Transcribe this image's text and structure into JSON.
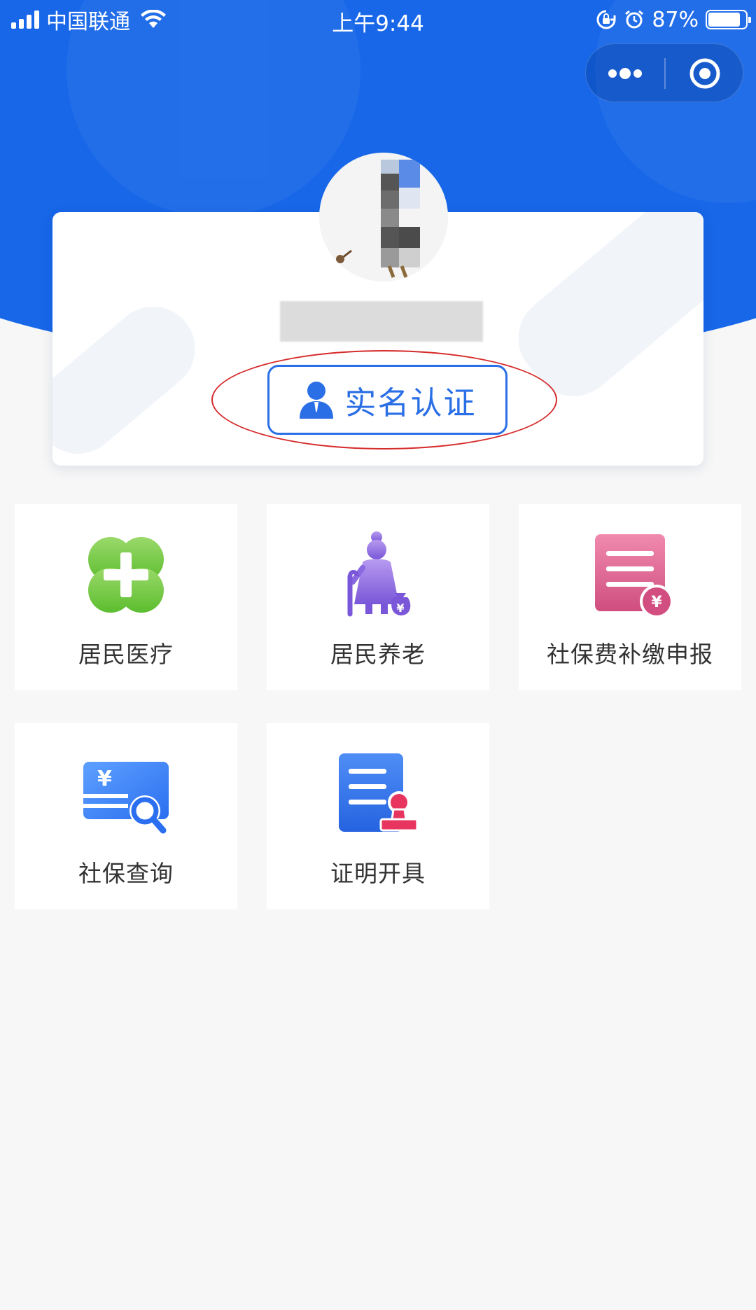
{
  "status_bar": {
    "carrier": "中国联通",
    "time": "上午9:44",
    "battery_percent": "87%",
    "battery_level": 0.87
  },
  "capsule": {
    "more_icon": "more-dots-icon",
    "close_icon": "target-close-icon"
  },
  "profile": {
    "verify_button_label": "实名认证",
    "verify_icon": "user-icon",
    "highlight_color": "#d62b2b"
  },
  "services": [
    {
      "label": "居民医疗",
      "icon": "medical-cross-icon"
    },
    {
      "label": "居民养老",
      "icon": "elderly-pension-icon"
    },
    {
      "label": "社保费补缴申报",
      "icon": "payment-document-icon"
    },
    {
      "label": "社保查询",
      "icon": "card-search-icon"
    },
    {
      "label": "证明开具",
      "icon": "certificate-stamp-icon"
    }
  ],
  "colors": {
    "header_blue": "#1767e8",
    "accent_blue": "#2a6fe5",
    "background": "#f7f7f7"
  }
}
